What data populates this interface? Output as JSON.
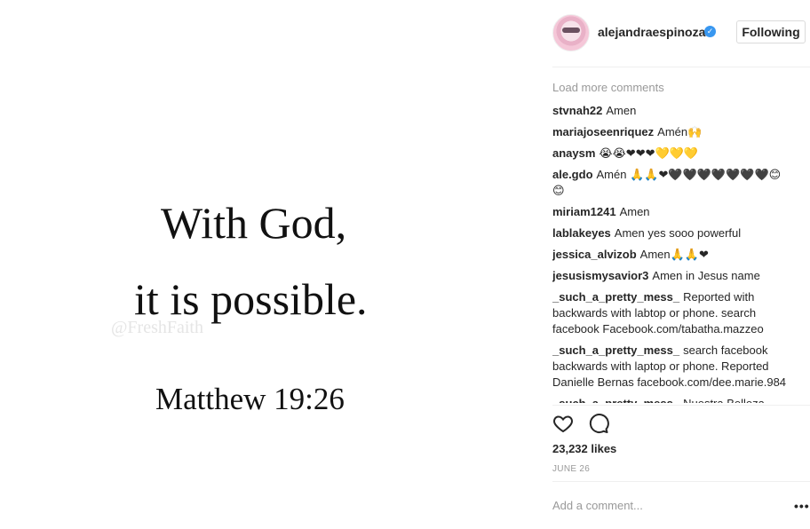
{
  "image": {
    "line1": "With God,",
    "line2": "it is possible.",
    "reference": "Matthew 19:26",
    "watermark": "@FreshFaith"
  },
  "header": {
    "username": "alejandraespinoza",
    "follow_label": "Following"
  },
  "comments": {
    "load_more": "Load more comments",
    "items": [
      {
        "user": "stvnah22",
        "text": "Amen"
      },
      {
        "user": "mariajoseenriquez",
        "text": "Amén🙌"
      },
      {
        "user": "anaysm",
        "text": "😭😭❤❤❤💛💛💛"
      },
      {
        "user": "ale.gdo",
        "text": "Amén 🙏🙏❤🖤🖤🖤🖤🖤🖤🖤😊😊"
      },
      {
        "user": "miriam1241",
        "text": "Amen"
      },
      {
        "user": "lablakeyes",
        "text": "Amen yes sooo powerful"
      },
      {
        "user": "jessica_alvizob",
        "text": "Amen🙏🙏❤"
      },
      {
        "user": "jesusismysavior3",
        "text": "Amen in Jesus name"
      },
      {
        "user": "_such_a_pretty_mess_",
        "text": "Reported with backwards with labtop or phone. search facebook Facebook.com/tabatha.mazzeo"
      },
      {
        "user": "_such_a_pretty_mess_",
        "text": "search facebook backwards with laptop or phone. Reported Danielle Bernas facebook.com/dee.marie.984"
      },
      {
        "user": "_such_a_pretty_mess_",
        "text": "Nuestra Belleza"
      }
    ]
  },
  "likes": "23,232 likes",
  "date": "JUNE 26",
  "add_comment_placeholder": "Add a comment...",
  "more_label": "•••",
  "colors": {
    "verified": "#3897f0",
    "muted": "#999999",
    "border": "#efefef"
  }
}
